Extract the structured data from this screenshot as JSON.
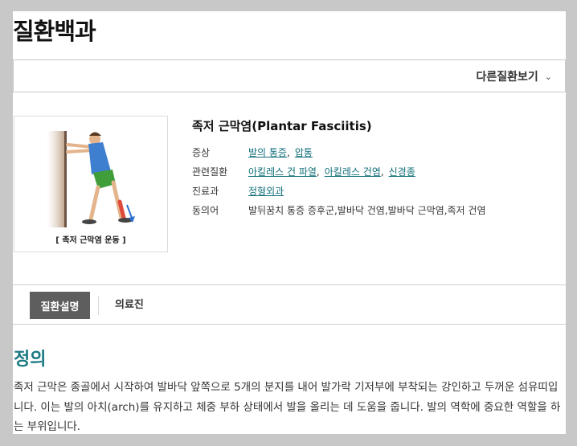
{
  "page": {
    "title": "질환백과"
  },
  "other_disease": {
    "label": "다른질환보기",
    "icon": "chevron-down-icon"
  },
  "disease": {
    "name": "족저 근막염(Plantar Fasciitis)",
    "image_caption": "[ 족저 근막염 운동 ]",
    "info": {
      "symptoms": {
        "label": "증상",
        "links": [
          "발의 통증",
          "압통"
        ]
      },
      "related": {
        "label": "관련질환",
        "links": [
          "아킬레스 건 파열",
          "아킬레스 건염",
          "신경종"
        ]
      },
      "department": {
        "label": "진료과",
        "links": [
          "정형외과"
        ]
      },
      "synonyms": {
        "label": "동의어",
        "value": "발뒤꿈치 통증 증후군,발바닥 건염,발바닥 근막염,족저 건염"
      }
    }
  },
  "tabs": [
    "질환설명",
    "의료진"
  ],
  "section": {
    "title": "정의",
    "body": "족저 근막은 종골에서 시작하여 발바닥 앞쪽으로 5개의 분지를 내어 발가락 기저부에 부착되는 강인하고 두꺼운 섬유띠입니다. 이는 발의 아치(arch)를 유지하고 체중 부하 상태에서 발을 올리는 데 도움을 줍니다. 발의 역학에 중요한 역할을 하는 부위입니다."
  },
  "colors": {
    "link": "#106f7a",
    "section_title": "#1c7a82",
    "active_tab": "#5e5e5e"
  }
}
